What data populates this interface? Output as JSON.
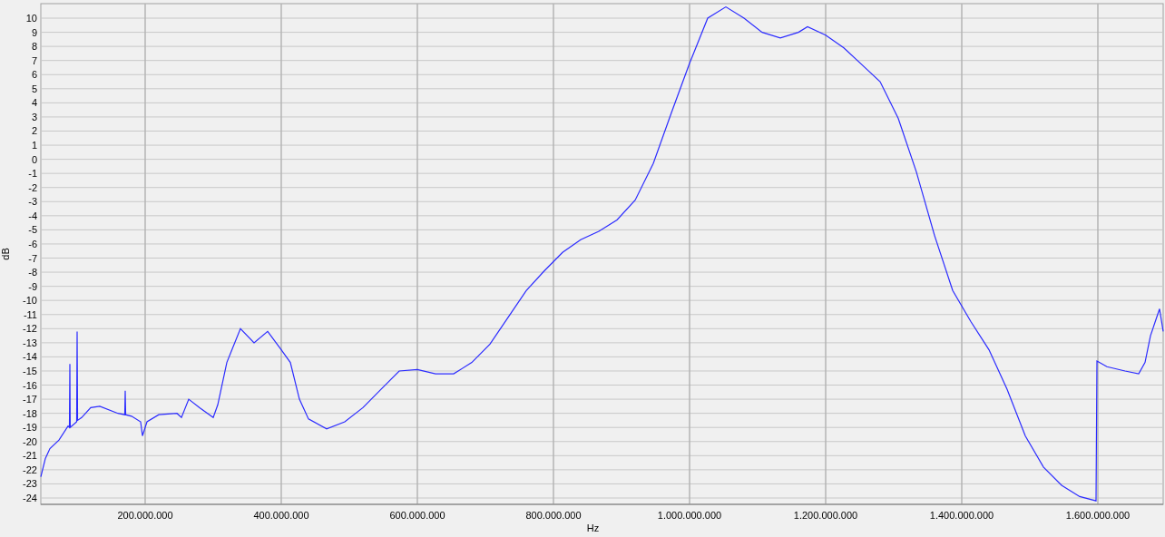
{
  "chart": {
    "chart_data": {
      "type": "line",
      "grid": true,
      "xlabel": "Hz",
      "ylabel": "dB",
      "xlim": [
        46700000,
        1696000000
      ],
      "ylim": [
        -24.45,
        11.03
      ],
      "xticks": [
        {
          "value": 200000000,
          "label": "200.000.000"
        },
        {
          "value": 400000000,
          "label": "400.000.000"
        },
        {
          "value": 600000000,
          "label": "600.000.000"
        },
        {
          "value": 800000000,
          "label": "800.000.000"
        },
        {
          "value": 1000000000,
          "label": "1.000.000.000"
        },
        {
          "value": 1200000000,
          "label": "1.200.000.000"
        },
        {
          "value": 1400000000,
          "label": "1.400.000.000"
        },
        {
          "value": 1600000000,
          "label": "1.600.000.000"
        }
      ],
      "yticks": [
        10,
        9,
        8,
        7,
        6,
        5,
        4,
        3,
        2,
        1,
        0,
        -1,
        -2,
        -3,
        -4,
        -5,
        -6,
        -7,
        -8,
        -9,
        -10,
        -11,
        -12,
        -13,
        -14,
        -15,
        -16,
        -17,
        -18,
        -19,
        -20,
        -21,
        -22,
        -23,
        -24
      ],
      "x": [
        46700000,
        53300000,
        60000000,
        73300000,
        86700000,
        88700000,
        89300000,
        89900000,
        99300000,
        100000000,
        100700000,
        106700000,
        120000000,
        133300000,
        160000000,
        170000000,
        170700000,
        171400000,
        180000000,
        193300000,
        196000000,
        202700000,
        220000000,
        246700000,
        253300000,
        264000000,
        280000000,
        300000000,
        306700000,
        320000000,
        340000000,
        360000000,
        380000000,
        400000000,
        413300000,
        426700000,
        440000000,
        466700000,
        493300000,
        520000000,
        546700000,
        573300000,
        600000000,
        626700000,
        653300000,
        680000000,
        706700000,
        733300000,
        760000000,
        786700000,
        813300000,
        840000000,
        866700000,
        893300000,
        920000000,
        946700000,
        973300000,
        1000000000,
        1026700000,
        1053300000,
        1080000000,
        1106700000,
        1133300000,
        1160000000,
        1173300000,
        1200000000,
        1226700000,
        1253300000,
        1280000000,
        1306700000,
        1333300000,
        1360000000,
        1386700000,
        1413300000,
        1440000000,
        1466700000,
        1493300000,
        1520000000,
        1546700000,
        1573300000,
        1597300000,
        1598700000,
        1613300000,
        1640000000,
        1660000000,
        1669300000,
        1677300000,
        1690700000,
        1696000000
      ],
      "series": [
        {
          "color": "#2b2bff",
          "values": [
            -22.5,
            -21.2,
            -20.5,
            -19.9,
            -18.9,
            -19.0,
            -14.5,
            -19.0,
            -18.6,
            -12.2,
            -18.5,
            -18.3,
            -17.6,
            -17.5,
            -18.0,
            -18.1,
            -16.4,
            -18.1,
            -18.2,
            -18.6,
            -19.6,
            -18.6,
            -18.1,
            -18.0,
            -18.3,
            -17.0,
            -17.6,
            -18.3,
            -17.4,
            -14.4,
            -12.0,
            -13.0,
            -12.2,
            -13.5,
            -14.4,
            -17.0,
            -18.4,
            -19.1,
            -18.6,
            -17.6,
            -16.3,
            -15.0,
            -14.9,
            -15.2,
            -15.2,
            -14.4,
            -13.1,
            -11.2,
            -9.3,
            -7.9,
            -6.6,
            -5.7,
            -5.1,
            -4.3,
            -2.9,
            -0.3,
            3.3,
            6.8,
            10.0,
            10.8,
            10.0,
            9.0,
            8.6,
            9.0,
            9.4,
            8.8,
            7.9,
            6.7,
            5.5,
            2.9,
            -0.9,
            -5.4,
            -9.3,
            -11.5,
            -13.5,
            -16.3,
            -19.6,
            -21.8,
            -23.1,
            -23.9,
            -24.2,
            -14.3,
            -14.7,
            -15.0,
            -15.2,
            -14.4,
            -12.5,
            -10.6,
            -12.2
          ]
        }
      ]
    }
  }
}
